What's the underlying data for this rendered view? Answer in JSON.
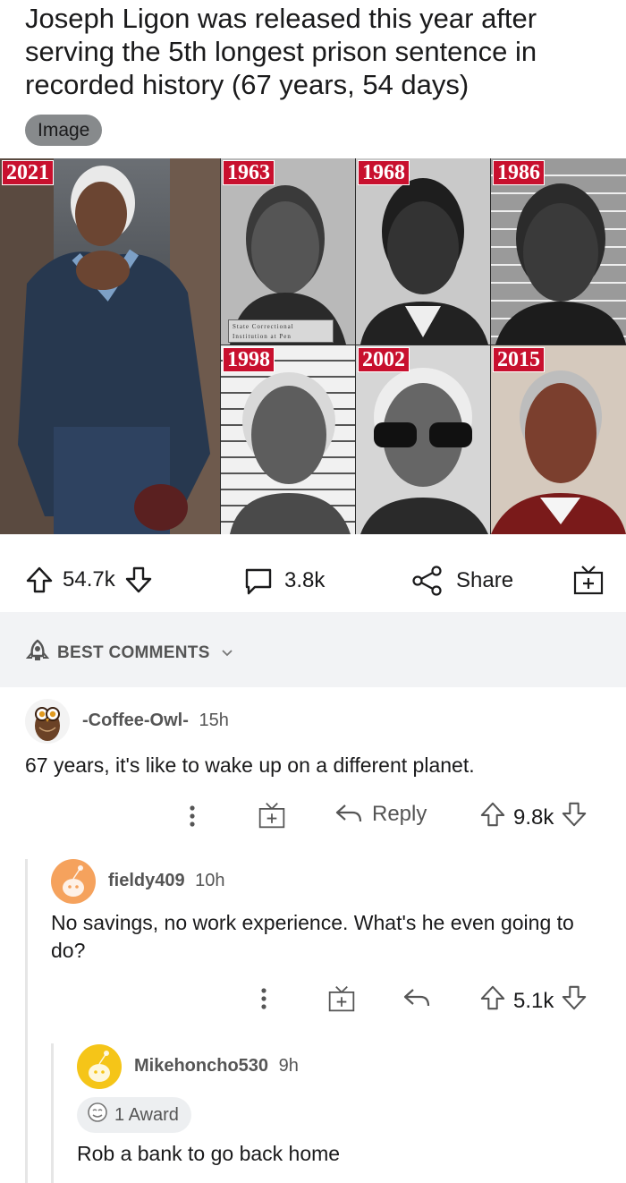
{
  "post": {
    "title": "Joseph Ligon was released this year after serving the 5th longest prison sentence in recorded history (67 years, 54 days)",
    "flair": "Image",
    "image": {
      "years": [
        "2021",
        "1963",
        "1968",
        "1986",
        "1998",
        "2002",
        "2015"
      ],
      "placard_line1": "State Correctional",
      "placard_line2": "Institution at Pen"
    },
    "upvotes": "54.7k",
    "comments": "3.8k",
    "share_label": "Share"
  },
  "sort": {
    "label": "BEST COMMENTS"
  },
  "comments": [
    {
      "username": "-Coffee-Owl-",
      "time": "15h",
      "text": "67 years, it's like to wake up on a different planet.",
      "reply_label": "Reply",
      "score": "9.8k"
    },
    {
      "username": "fieldy409",
      "time": "10h",
      "text": "No savings, no work experience. What's he even going to do?",
      "score": "5.1k"
    },
    {
      "username": "Mikehoncho530",
      "time": "9h",
      "award": "1 Award",
      "text": "Rob a bank to go back home"
    }
  ],
  "colors": {
    "flair_bg": "#878a8c",
    "year_badge": "#c8102e",
    "section_bg": "#f2f3f5",
    "avatar_orange": "#f5a25d",
    "avatar_yellow": "#f5c518"
  }
}
